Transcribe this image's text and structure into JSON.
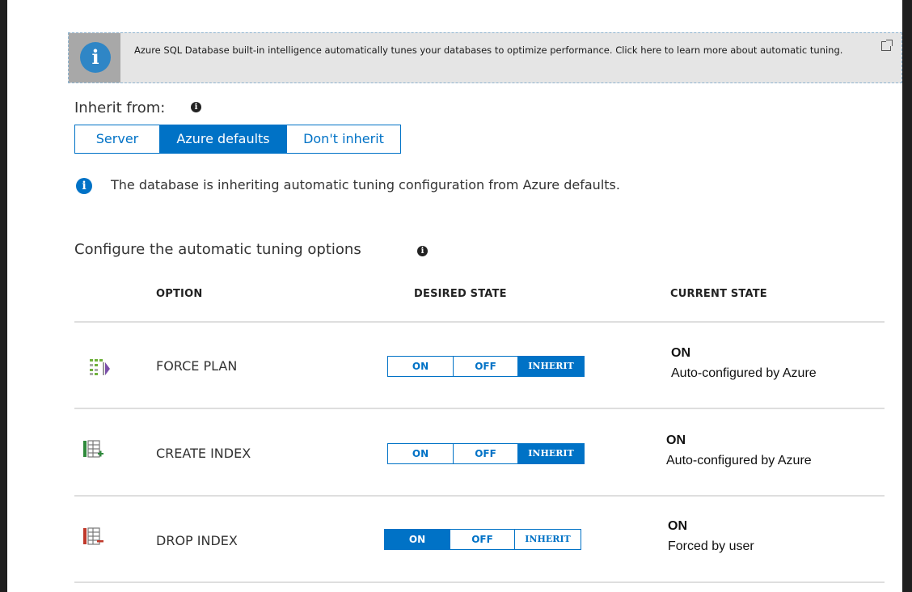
{
  "banner": {
    "icon": "info-icon",
    "text": "Azure SQL Database built-in intelligence automatically tunes your databases to optimize performance. Click here to learn more about automatic tuning.",
    "link_icon": "external-link-icon"
  },
  "inherit": {
    "label": "Inherit from:",
    "options": [
      "Server",
      "Azure defaults",
      "Don't inherit"
    ],
    "selected": "Azure defaults"
  },
  "notice": {
    "text": "The database is inheriting automatic tuning configuration from Azure defaults."
  },
  "configure": {
    "label": "Configure the automatic tuning options",
    "columns": [
      "OPTION",
      "DESIRED STATE",
      "CURRENT STATE"
    ]
  },
  "options": [
    {
      "icon": "force-plan-icon",
      "name": "FORCE PLAN",
      "desired": {
        "on": "ON",
        "off": "OFF",
        "inherit": "INHERIT",
        "selected": "INHERIT"
      },
      "current_value": "ON",
      "current_detail": "Auto-configured by Azure"
    },
    {
      "icon": "create-index-icon",
      "name": "CREATE INDEX",
      "desired": {
        "on": "ON",
        "off": "OFF",
        "inherit": "INHERIT",
        "selected": "INHERIT"
      },
      "current_value": "ON",
      "current_detail": "Auto-configured by Azure"
    },
    {
      "icon": "drop-index-icon",
      "name": "DROP INDEX",
      "desired": {
        "on": "ON",
        "off": "OFF",
        "inherit": "INHERIT",
        "selected": "ON"
      },
      "current_value": "ON",
      "current_detail": "Forced by user"
    }
  ],
  "colors": {
    "accent": "#0072c6",
    "banner_bg": "#e5e5e5",
    "divider": "#dedede"
  }
}
